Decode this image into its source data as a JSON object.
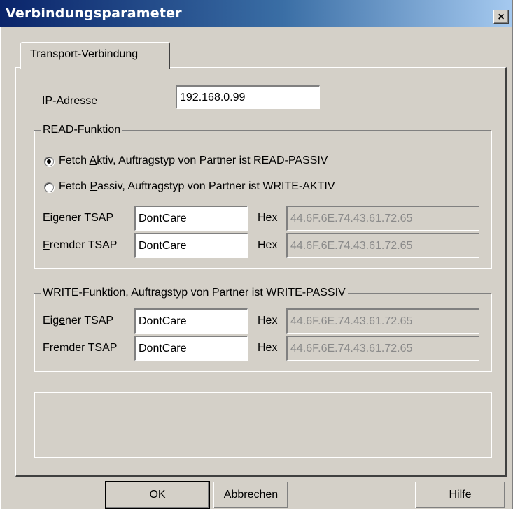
{
  "window": {
    "title": "Verbindungsparameter",
    "close_glyph": "×"
  },
  "tab": {
    "label": "Transport-Verbindung"
  },
  "ip": {
    "label": "IP-Adresse",
    "value": "192.168.0.99"
  },
  "read": {
    "group_label": "READ-Funktion",
    "radio_active": {
      "pre": "Fetch ",
      "ul": "A",
      "post": "ktiv,   Auftragstyp von Partner ist READ-PASSIV",
      "checked": true
    },
    "radio_passive": {
      "pre": "Fetch ",
      "ul": "P",
      "post": "assiv, Auftragstyp von Partner ist WRITE-AKTIV",
      "checked": false
    },
    "own_tsap": {
      "pre": "Ei",
      "ul": "g",
      "post": "ener TSAP",
      "value": "DontCare",
      "hex_label": "Hex",
      "hex_value": "44.6F.6E.74.43.61.72.65"
    },
    "foreign_tsap": {
      "pre": "",
      "ul": "F",
      "post": "remder TSAP",
      "value": "DontCare",
      "hex_label": "Hex",
      "hex_value": "44.6F.6E.74.43.61.72.65"
    }
  },
  "write": {
    "group_label": "WRITE-Funktion, Auftragstyp von Partner ist WRITE-PASSIV",
    "own_tsap": {
      "pre": "Eig",
      "ul": "e",
      "post": "ner TSAP",
      "value": "DontCare",
      "hex_label": "Hex",
      "hex_value": "44.6F.6E.74.43.61.72.65"
    },
    "foreign_tsap": {
      "pre": "F",
      "ul": "r",
      "post": "emder TSAP",
      "value": "DontCare",
      "hex_label": "Hex",
      "hex_value": "44.6F.6E.74.43.61.72.65"
    }
  },
  "buttons": {
    "ok": "OK",
    "cancel": "Abbrechen",
    "help": "Hilfe"
  },
  "colors": {
    "face": "#d4d0c8",
    "title_start": "#0a246a",
    "title_end": "#a6caf0",
    "disabled_text": "#8a8a8a"
  }
}
